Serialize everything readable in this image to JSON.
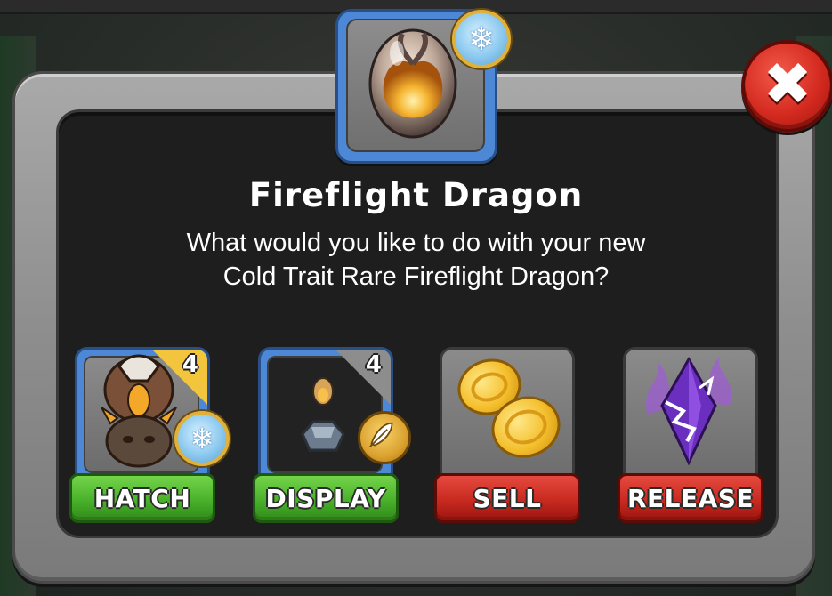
{
  "dialog": {
    "title": "Fireflight Dragon",
    "description_line1": "What would you like to do with your new",
    "description_line2": "Cold Trait Rare Fireflight Dragon?",
    "close_icon": "close-icon",
    "egg_trait_icon": "snowflake-icon"
  },
  "options": [
    {
      "id": "hatch",
      "label": "HATCH",
      "count": "4",
      "icon": "dragon-icon",
      "badge": "snowflake-icon",
      "button_color": "#4ab12b"
    },
    {
      "id": "display",
      "label": "DISPLAY",
      "count": "4",
      "icon": "egg-pedestal-icon",
      "badge": "feather-icon",
      "button_color": "#4ab12b"
    },
    {
      "id": "sell",
      "label": "SELL",
      "icon": "gold-coins-icon",
      "button_color": "#c82a20"
    },
    {
      "id": "release",
      "label": "RELEASE",
      "icon": "purple-crystal-icon",
      "button_color": "#c82a20"
    }
  ],
  "colors": {
    "accent_blue": "#4c88d6",
    "accent_gold": "#f2c53d",
    "close_red": "#d42a1f",
    "panel_dark": "#1e1e1e",
    "frame_gray": "#8e8e8e"
  }
}
